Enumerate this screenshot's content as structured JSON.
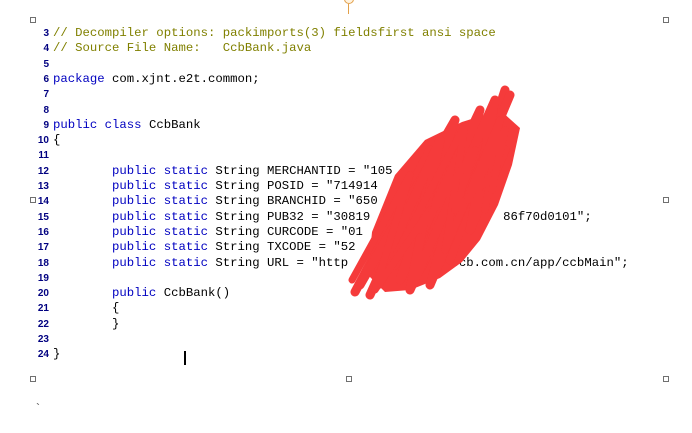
{
  "lines": [
    {
      "num": "3",
      "parts": [
        {
          "t": "// Decompiler options: packimports(3) fieldsfirst ansi space",
          "c": "cm"
        }
      ]
    },
    {
      "num": "4",
      "parts": [
        {
          "t": "// Source File Name:   CcbBank.java",
          "c": "cm"
        }
      ]
    },
    {
      "num": "5",
      "parts": []
    },
    {
      "num": "6",
      "parts": [
        {
          "t": "package",
          "c": "kw"
        },
        {
          "t": " com.xjnt.e2t.common;",
          "c": "pl"
        }
      ]
    },
    {
      "num": "7",
      "parts": []
    },
    {
      "num": "8",
      "parts": []
    },
    {
      "num": "9",
      "parts": [
        {
          "t": "public class",
          "c": "kw"
        },
        {
          "t": " CcbBank",
          "c": "pl"
        }
      ]
    },
    {
      "num": "10",
      "parts": [
        {
          "t": "{",
          "c": "pl"
        }
      ]
    },
    {
      "num": "11",
      "parts": []
    },
    {
      "num": "12",
      "parts": [
        {
          "t": "        public static",
          "c": "kw"
        },
        {
          "t": " String MERCHANTID = \"105",
          "c": "pl"
        }
      ]
    },
    {
      "num": "13",
      "parts": [
        {
          "t": "        public static",
          "c": "kw"
        },
        {
          "t": " String POSID = \"714914",
          "c": "pl"
        }
      ]
    },
    {
      "num": "14",
      "parts": [
        {
          "t": "        public static",
          "c": "kw"
        },
        {
          "t": " String BRANCHID = \"650",
          "c": "pl"
        }
      ]
    },
    {
      "num": "15",
      "parts": [
        {
          "t": "        public static",
          "c": "kw"
        },
        {
          "t": " String PUB32 = \"30819                  86f70d0101\";",
          "c": "pl"
        }
      ]
    },
    {
      "num": "16",
      "parts": [
        {
          "t": "        public static",
          "c": "kw"
        },
        {
          "t": " String CURCODE = \"01",
          "c": "pl"
        }
      ]
    },
    {
      "num": "17",
      "parts": [
        {
          "t": "        public static",
          "c": "kw"
        },
        {
          "t": " String TXCODE = \"52",
          "c": "pl"
        }
      ]
    },
    {
      "num": "18",
      "parts": [
        {
          "t": "        public static",
          "c": "kw"
        },
        {
          "t": " String URL = \"http              ccb.com.cn/app/ccbMain\";",
          "c": "pl"
        }
      ]
    },
    {
      "num": "19",
      "parts": []
    },
    {
      "num": "20",
      "parts": [
        {
          "t": "        public",
          "c": "kw"
        },
        {
          "t": " CcbBank()",
          "c": "pl"
        }
      ]
    },
    {
      "num": "21",
      "parts": [
        {
          "t": "        {",
          "c": "pl"
        }
      ]
    },
    {
      "num": "22",
      "parts": [
        {
          "t": "        }",
          "c": "pl"
        }
      ]
    },
    {
      "num": "23",
      "parts": []
    },
    {
      "num": "24",
      "parts": [
        {
          "t": "}",
          "c": "pl"
        }
      ]
    }
  ],
  "trailing_mark": "`",
  "colors": {
    "keyword": "#0000c0",
    "comment": "#808000",
    "line_number": "#000080",
    "redaction": "#f53b3b",
    "selection_handle": "#707070",
    "rotation_handle": "#e2a04a"
  }
}
